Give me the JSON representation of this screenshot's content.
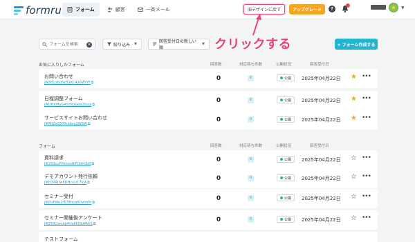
{
  "header": {
    "logo_text": "formrun",
    "tabs": [
      {
        "label": "フォーム",
        "icon": "forms-icon",
        "active": true
      },
      {
        "label": "顧客",
        "icon": "customers-icon",
        "active": false
      },
      {
        "label": "一斉メール",
        "icon": "mail-icon",
        "active": false
      }
    ],
    "old_design_label": "旧デザインに戻す",
    "upgrade_label": "アップグレード",
    "help_label": "?",
    "accent_color": "#21b5cf",
    "upgrade_color": "#f4a623"
  },
  "annotation": {
    "text": "クリックする",
    "color": "#e8427b"
  },
  "toolbar": {
    "search_placeholder": "フォームを検索",
    "clear_label": "×",
    "filter_label": "絞り込み",
    "sort_label": "回答受付日の新しい順",
    "create_label": "+ フォーム作成する"
  },
  "columns": {
    "responses": "回答数",
    "pending": "対応待ち件数",
    "status": "公開状況",
    "date": "回答受付日"
  },
  "favorites": {
    "label": "お気に入りしたフォーム",
    "rows": [
      {
        "name": "お問い合わせ",
        "link": "jIK8QLz6uNc52KC426WrYF",
        "responses": "0",
        "pending": "0",
        "status": "公開",
        "date": "2025年04月22日",
        "starred": true
      },
      {
        "name": "日程調整フォーム",
        "link": "jIKUHXMaG4ttmOGew2ksqi",
        "responses": "0",
        "pending": "0",
        "status": "公開",
        "date": "2025年04月22日",
        "starred": true
      },
      {
        "name": "サービスサイトお問い合わせ",
        "link": "jIKMfZz0000ckbsg2WSW",
        "responses": "0",
        "pending": "0",
        "status": "公開",
        "date": "2025年04月22日",
        "starred": true
      }
    ]
  },
  "forms": {
    "label": "フォーム",
    "rows": [
      {
        "name": "資料請求",
        "link": "jIK2S3cuFPkhmdkFQdmSdf",
        "responses": "0",
        "pending": "0",
        "status": "公開",
        "date": "2025年04月22日",
        "starred": false
      },
      {
        "name": "デモアカウント発行依頼",
        "link": "jIKtQ9RUwKDHcuUC7lcA",
        "responses": "0",
        "pending": "0",
        "status": "公開",
        "date": "2025年04月22日",
        "starred": false
      },
      {
        "name": "セミナー受付",
        "link": "jIKDsFWe2r578hua6DwmPr",
        "responses": "0",
        "pending": "0",
        "status": "公開",
        "date": "2025年04月22日",
        "starred": false
      },
      {
        "name": "セミナー開催後アンケート",
        "link": "jIKZUR1wsbp4UaM3TeAWkS",
        "responses": "0",
        "pending": "0",
        "status": "公開",
        "date": "2025年04月22日",
        "starred": false
      },
      {
        "name": "テストフォーム",
        "link": "",
        "responses": "",
        "pending": "",
        "status": "",
        "date": "",
        "starred": false
      }
    ]
  }
}
